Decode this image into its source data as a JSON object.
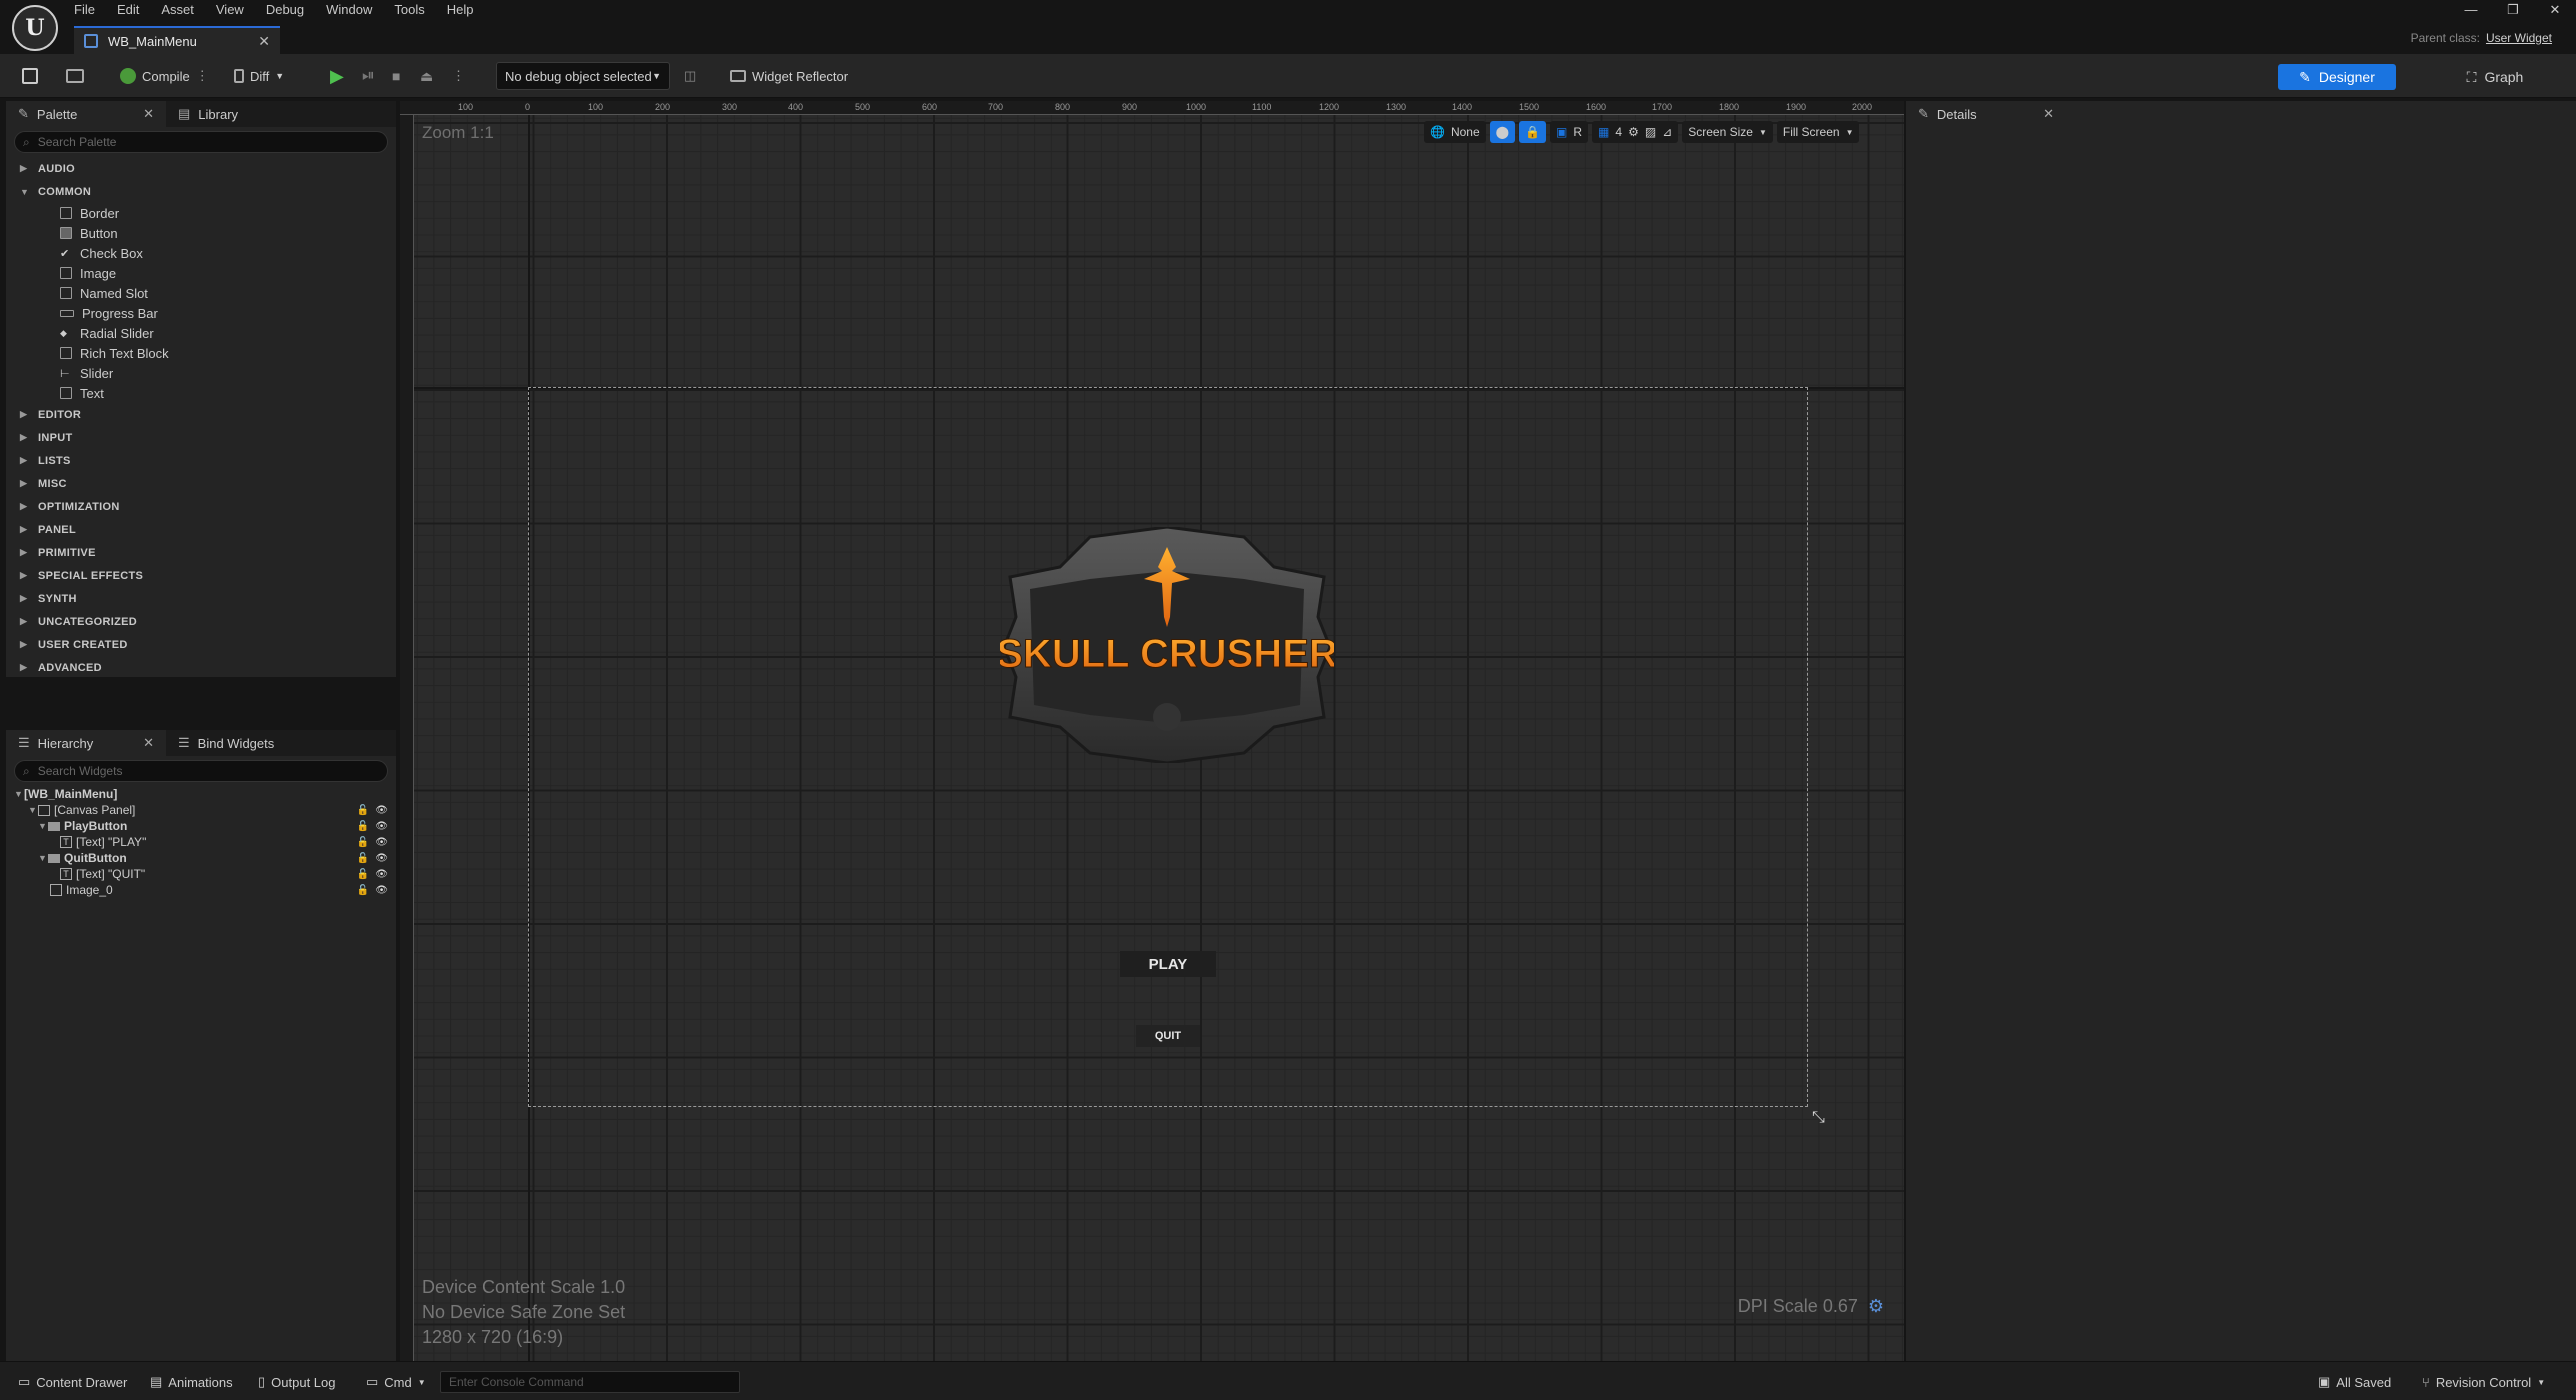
{
  "menu": [
    "File",
    "Edit",
    "Asset",
    "View",
    "Debug",
    "Window",
    "Tools",
    "Help"
  ],
  "document_tab": "WB_MainMenu",
  "parent_class": {
    "label": "Parent class:",
    "value": "User Widget"
  },
  "toolbar": {
    "compile": "Compile",
    "diff": "Diff",
    "debug_select": "No debug object selected",
    "widget_reflector": "Widget Reflector",
    "designer": "Designer",
    "graph": "Graph"
  },
  "palette": {
    "tab": "Palette",
    "library_tab": "Library",
    "search_placeholder": "Search Palette",
    "cat_audio": "AUDIO",
    "cat_common": "COMMON",
    "common_items": [
      "Border",
      "Button",
      "Check Box",
      "Image",
      "Named Slot",
      "Progress Bar",
      "Radial Slider",
      "Rich Text Block",
      "Slider",
      "Text"
    ],
    "categories": [
      "EDITOR",
      "INPUT",
      "LISTS",
      "MISC",
      "OPTIMIZATION",
      "PANEL",
      "PRIMITIVE",
      "SPECIAL EFFECTS",
      "SYNTH",
      "UNCATEGORIZED",
      "USER CREATED",
      "ADVANCED"
    ]
  },
  "hierarchy": {
    "tab": "Hierarchy",
    "bind_tab": "Bind Widgets",
    "search_placeholder": "Search Widgets",
    "rows": [
      "[WB_MainMenu]",
      "[Canvas Panel]",
      "PlayButton",
      "[Text] \"PLAY\"",
      "QuitButton",
      "[Text] \"QUIT\"",
      "Image_0"
    ]
  },
  "viewport": {
    "zoom": "Zoom 1:1",
    "ruler_labels": [
      "100",
      "0",
      "100",
      "200",
      "300",
      "400",
      "500",
      "600",
      "700",
      "800",
      "900",
      "1000",
      "1100",
      "1200",
      "1300",
      "1400",
      "1500",
      "1600",
      "1700",
      "1800",
      "1900",
      "2000"
    ],
    "tools": {
      "none": "None",
      "r": "R",
      "grid": "4",
      "screen_size": "Screen Size",
      "fill_screen": "Fill Screen"
    },
    "logo_text": "SKULL CRUSHER",
    "play": "PLAY",
    "quit": "QUIT",
    "device_scale": "Device Content Scale 1.0",
    "safe_zone": "No Device Safe Zone Set",
    "resolution": "1280 x 720 (16:9)",
    "dpi": "DPI Scale 0.67"
  },
  "details": {
    "tab": "Details"
  },
  "status": {
    "content_drawer": "Content Drawer",
    "animations": "Animations",
    "output_log": "Output Log",
    "cmd": "Cmd",
    "cmd_placeholder": "Enter Console Command",
    "all_saved": "All Saved",
    "revision": "Revision Control"
  },
  "colors": {
    "accent": "#1a74e0",
    "logo_orange": "#f08a1a"
  }
}
